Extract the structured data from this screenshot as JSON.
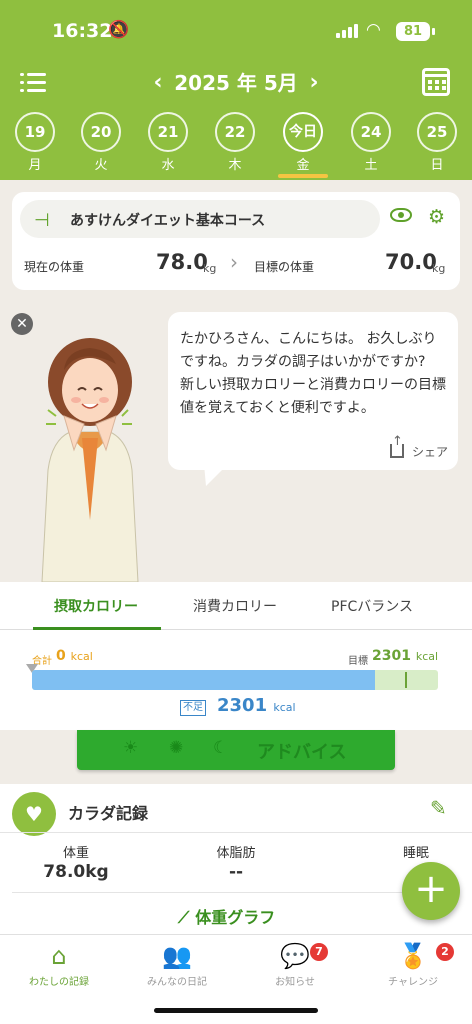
{
  "status_bar": {
    "time": "16:32",
    "battery": "81"
  },
  "header": {
    "month_label": "2025 年 5月",
    "prev": "‹",
    "next": "›",
    "days": [
      {
        "num": "19",
        "wd": "月"
      },
      {
        "num": "20",
        "wd": "火"
      },
      {
        "num": "21",
        "wd": "水"
      },
      {
        "num": "22",
        "wd": "木"
      },
      {
        "num": "今日",
        "wd": "金"
      },
      {
        "num": "24",
        "wd": "土"
      },
      {
        "num": "25",
        "wd": "日"
      }
    ]
  },
  "course": {
    "name": "あすけんダイエット基本コース",
    "current_label": "現在の体重",
    "current_value": "78.0",
    "goal_label": "目標の体重",
    "goal_value": "70.0",
    "unit": "kg"
  },
  "advice": {
    "message": "たかひろさん、こんにちは。 お久しぶりですね。カラダの調子はいかがですか?\n新しい摂取カロリーと消費カロリーの目標値を覚えておくと便利ですよ。",
    "share_label": "シェア"
  },
  "calorie": {
    "tabs": [
      "摂取カロリー",
      "消費カロリー",
      "PFCバランス"
    ],
    "total_label": "合計",
    "total_value": "0",
    "goal_label": "目標",
    "goal_value": "2301",
    "unit": "kcal",
    "lack_label": "不足",
    "lack_value": "2301",
    "fill_fraction": 0.845,
    "advice_button": "アドバイス"
  },
  "record": {
    "title": "カラダ記録",
    "items": [
      {
        "label": "体重",
        "value": "78.0kg"
      },
      {
        "label": "体脂肪",
        "value": "--"
      },
      {
        "label": "睡眠",
        "value": ""
      }
    ],
    "graph_link": "体重グラフ"
  },
  "bottom_nav": [
    {
      "label": "わたしの記録",
      "icon": "home-icon"
    },
    {
      "label": "みんなの日記",
      "icon": "people-icon"
    },
    {
      "label": "お知らせ",
      "icon": "chat-icon",
      "badge": "7"
    },
    {
      "label": "チャレンジ",
      "icon": "medal-icon",
      "badge": "2"
    }
  ],
  "colors": {
    "brand": "#8fbf3f",
    "accent": "#3a8f1f",
    "deficit": "#3a86c8"
  }
}
